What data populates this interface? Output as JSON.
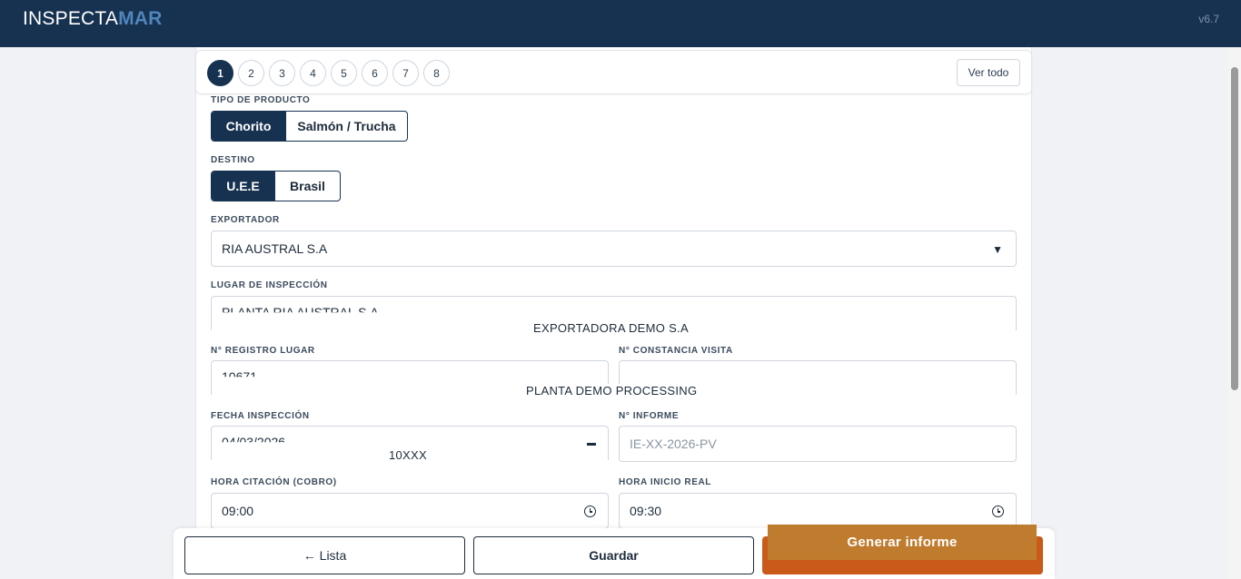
{
  "header": {
    "logo_part1": "INSPECTA",
    "logo_part2": "MAR",
    "version": "v6.7"
  },
  "steps": {
    "items": [
      "1",
      "2",
      "3",
      "4",
      "5",
      "6",
      "7",
      "8"
    ],
    "active": "1",
    "view_all_label": "Ver todo"
  },
  "form": {
    "tipo_producto": {
      "label": "TIPO DE PRODUCTO",
      "options": [
        "Chorito",
        "Salmón / Trucha"
      ],
      "selected": "Chorito"
    },
    "destino": {
      "label": "DESTINO",
      "options": [
        "U.E.E",
        "Brasil"
      ],
      "selected": "U.E.E"
    },
    "exportador": {
      "label": "EXPORTADOR",
      "value": "RIA AUSTRAL S.A",
      "caret": "▼"
    },
    "lugar_inspeccion": {
      "label": "LUGAR DE INSPECCIÓN",
      "value": "PLANTA RIA AUSTRAL S.A"
    },
    "registro_lugar": {
      "label": "N° REGISTRO LUGAR",
      "value": "10671"
    },
    "constancia_visita": {
      "label": "N° CONSTANCIA VISITA",
      "value": ""
    },
    "fecha_inspeccion": {
      "label": "FECHA INSPECCIÓN",
      "value": "04/03/2026"
    },
    "n_informe": {
      "label": "N° INFORME",
      "placeholder": "IE-XX-2026-PV"
    },
    "hora_citacion": {
      "label": "HORA CITACIÓN (COBRO)",
      "value": "09:00"
    },
    "hora_inicio": {
      "label": "HORA INICIO REAL",
      "value": "09:30"
    }
  },
  "overlays": {
    "exportadora": "EXPORTADORA DEMO S.A",
    "planta": "PLANTA DEMO PROCESSING",
    "registro": "10XXX"
  },
  "actions": {
    "lista": "← Lista",
    "guardar": "Guardar",
    "generar": "Generar informe"
  }
}
